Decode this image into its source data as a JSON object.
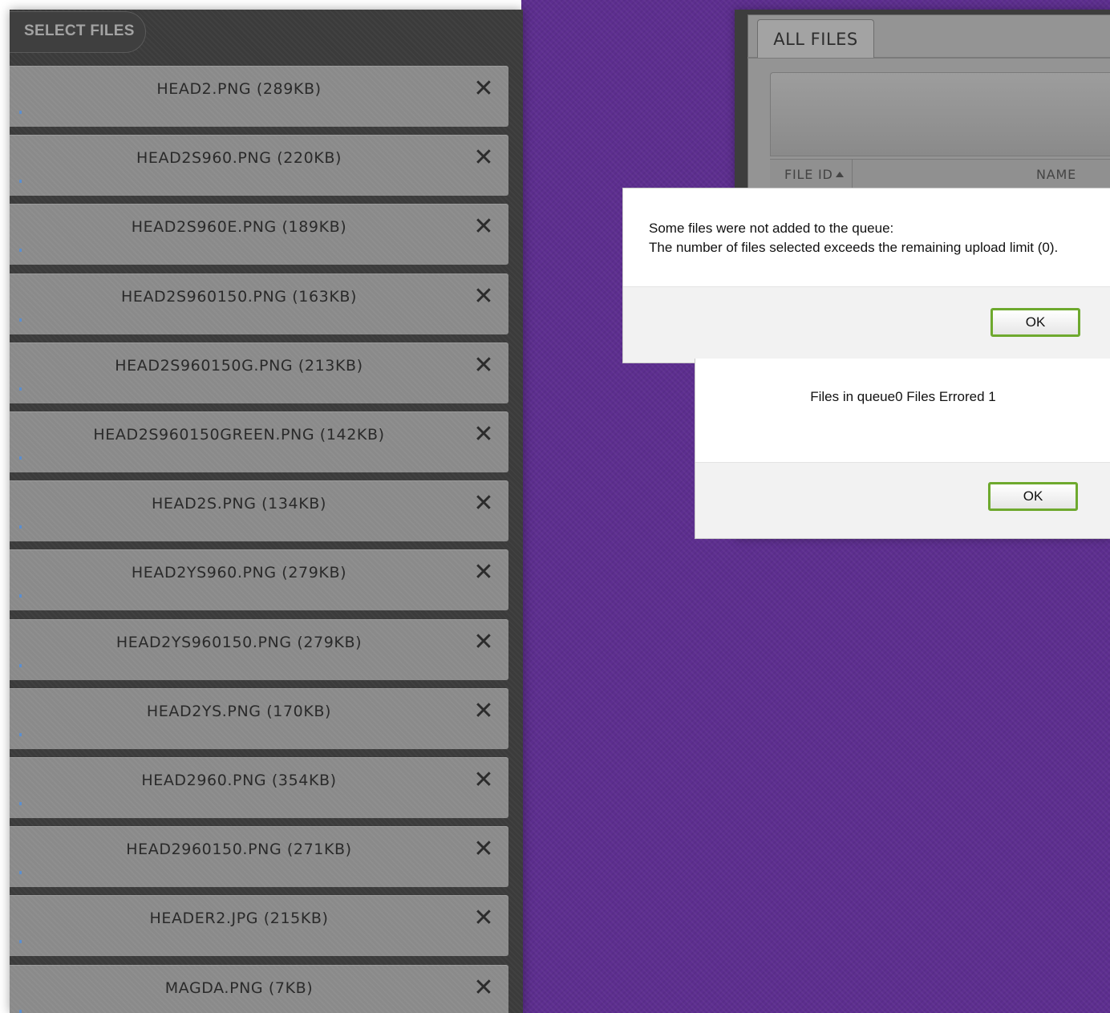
{
  "uploader": {
    "select_files_label": "SELECT FILES",
    "remove_glyph": "✕",
    "files": [
      {
        "label": "HEAD2.PNG (289KB)"
      },
      {
        "label": "HEAD2S960.PNG (220KB)"
      },
      {
        "label": "HEAD2S960E.PNG (189KB)"
      },
      {
        "label": "HEAD2S960150.PNG (163KB)"
      },
      {
        "label": "HEAD2S960150G.PNG (213KB)"
      },
      {
        "label": "HEAD2S960150GREEN.PNG (142KB)"
      },
      {
        "label": "HEAD2S.PNG (134KB)"
      },
      {
        "label": "HEAD2YS960.PNG (279KB)"
      },
      {
        "label": "HEAD2YS960150.PNG (279KB)"
      },
      {
        "label": "HEAD2YS.PNG (170KB)"
      },
      {
        "label": "HEAD2960.PNG (354KB)"
      },
      {
        "label": "HEAD2960150.PNG (271KB)"
      },
      {
        "label": "HEADER2.JPG (215KB)"
      },
      {
        "label": "MAGDA.PNG (7KB)"
      }
    ]
  },
  "file_manager": {
    "tab_label": "ALL FILES",
    "columns": [
      "FILE ID",
      "NAME"
    ]
  },
  "dialogs": {
    "queue_error": {
      "line1": "Some files were not added to the queue:",
      "line2": "The number of files selected exceeds the remaining upload limit (0).",
      "ok_label": "OK"
    },
    "queue_summary": {
      "message": "Files in queue0 Files Errored 1",
      "ok_label": "OK"
    }
  },
  "colors": {
    "background_purple": "#5d2e8f",
    "panel_dark": "#3b3b3b",
    "row_gray": "#8a8a8a",
    "ok_border_green": "#6ea92e"
  }
}
